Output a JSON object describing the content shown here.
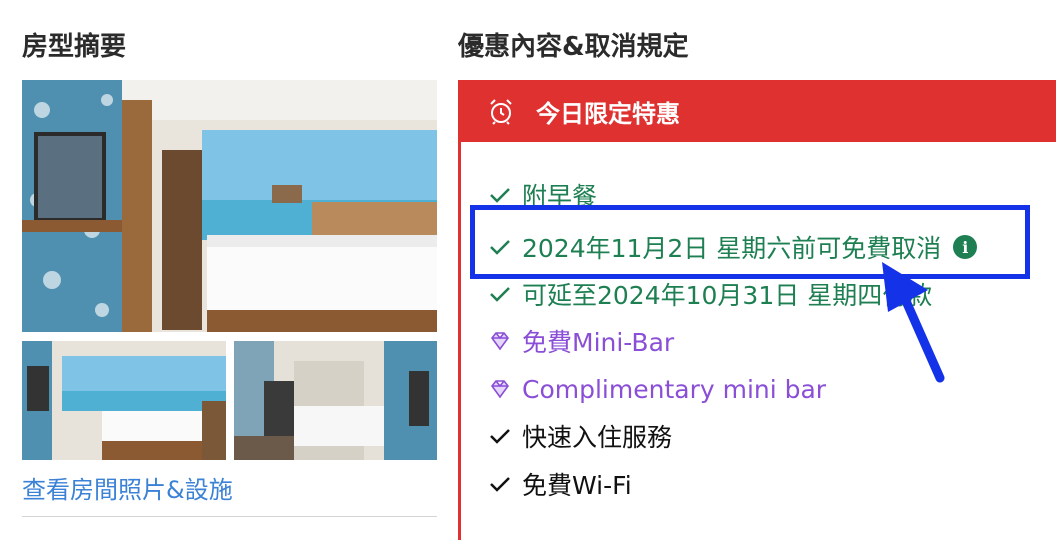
{
  "room_summary": {
    "title": "房型摘要",
    "view_link": "查看房間照片&設施"
  },
  "offer": {
    "title": "優惠內容&取消規定",
    "banner": "今日限定特惠",
    "items": [
      {
        "icon": "check-icon",
        "text": "附早餐",
        "color": "#1e7f52"
      },
      {
        "icon": "check-icon",
        "text": "2024年11月2日 星期六前可免費取消",
        "color": "#1e7f52",
        "info": "i"
      },
      {
        "icon": "check-icon",
        "text": "可延至2024年10月31日 星期四付款",
        "color": "#1e7f52"
      },
      {
        "icon": "diamond-icon",
        "text": "免費Mini-Bar",
        "color": "#8a4fd6"
      },
      {
        "icon": "diamond-icon",
        "text": "Complimentary mini bar",
        "color": "#8a4fd6"
      },
      {
        "icon": "check-icon",
        "text": "快速入住服務",
        "color": "#111111"
      },
      {
        "icon": "check-icon",
        "text": "免費Wi-Fi",
        "color": "#111111"
      }
    ]
  },
  "colors": {
    "accent_red": "#e03131",
    "annotation_blue": "#1432e8",
    "link_blue": "#3b82d6"
  }
}
